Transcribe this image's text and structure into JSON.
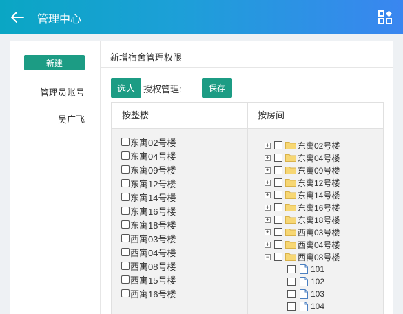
{
  "header": {
    "title": "管理中心"
  },
  "sidebar": {
    "new_label": "新建",
    "items": [
      {
        "label": "管理员账号"
      },
      {
        "label": "吴广飞"
      }
    ]
  },
  "main": {
    "title": "新增宿舍管理权限",
    "select_label": "选人",
    "auth_label": "授权管理:",
    "save_label": "保存"
  },
  "table": {
    "col1_header": "按整楼",
    "col2_header": "按房间",
    "buildings": [
      "东寓02号楼",
      "东寓04号楼",
      "东寓09号楼",
      "东寓12号楼",
      "东寓14号楼",
      "东寓16号楼",
      "东寓18号楼",
      "西寓03号楼",
      "西寓04号楼",
      "西寓08号楼",
      "西寓15号楼",
      "西寓16号楼"
    ],
    "tree": [
      {
        "label": "东寓02号楼",
        "toggle": "+"
      },
      {
        "label": "东寓04号楼",
        "toggle": "+"
      },
      {
        "label": "东寓09号楼",
        "toggle": "+"
      },
      {
        "label": "东寓12号楼",
        "toggle": "+"
      },
      {
        "label": "东寓14号楼",
        "toggle": "+"
      },
      {
        "label": "东寓16号楼",
        "toggle": "+"
      },
      {
        "label": "东寓18号楼",
        "toggle": "+"
      },
      {
        "label": "西寓03号楼",
        "toggle": "+"
      },
      {
        "label": "西寓04号楼",
        "toggle": "+"
      },
      {
        "label": "西寓08号楼",
        "toggle": "−"
      }
    ],
    "rooms": [
      "101",
      "102",
      "103",
      "104"
    ]
  },
  "colors": {
    "accent": "#1c9c84",
    "header_start": "#0aa6c4",
    "header_end": "#3a86f0"
  }
}
